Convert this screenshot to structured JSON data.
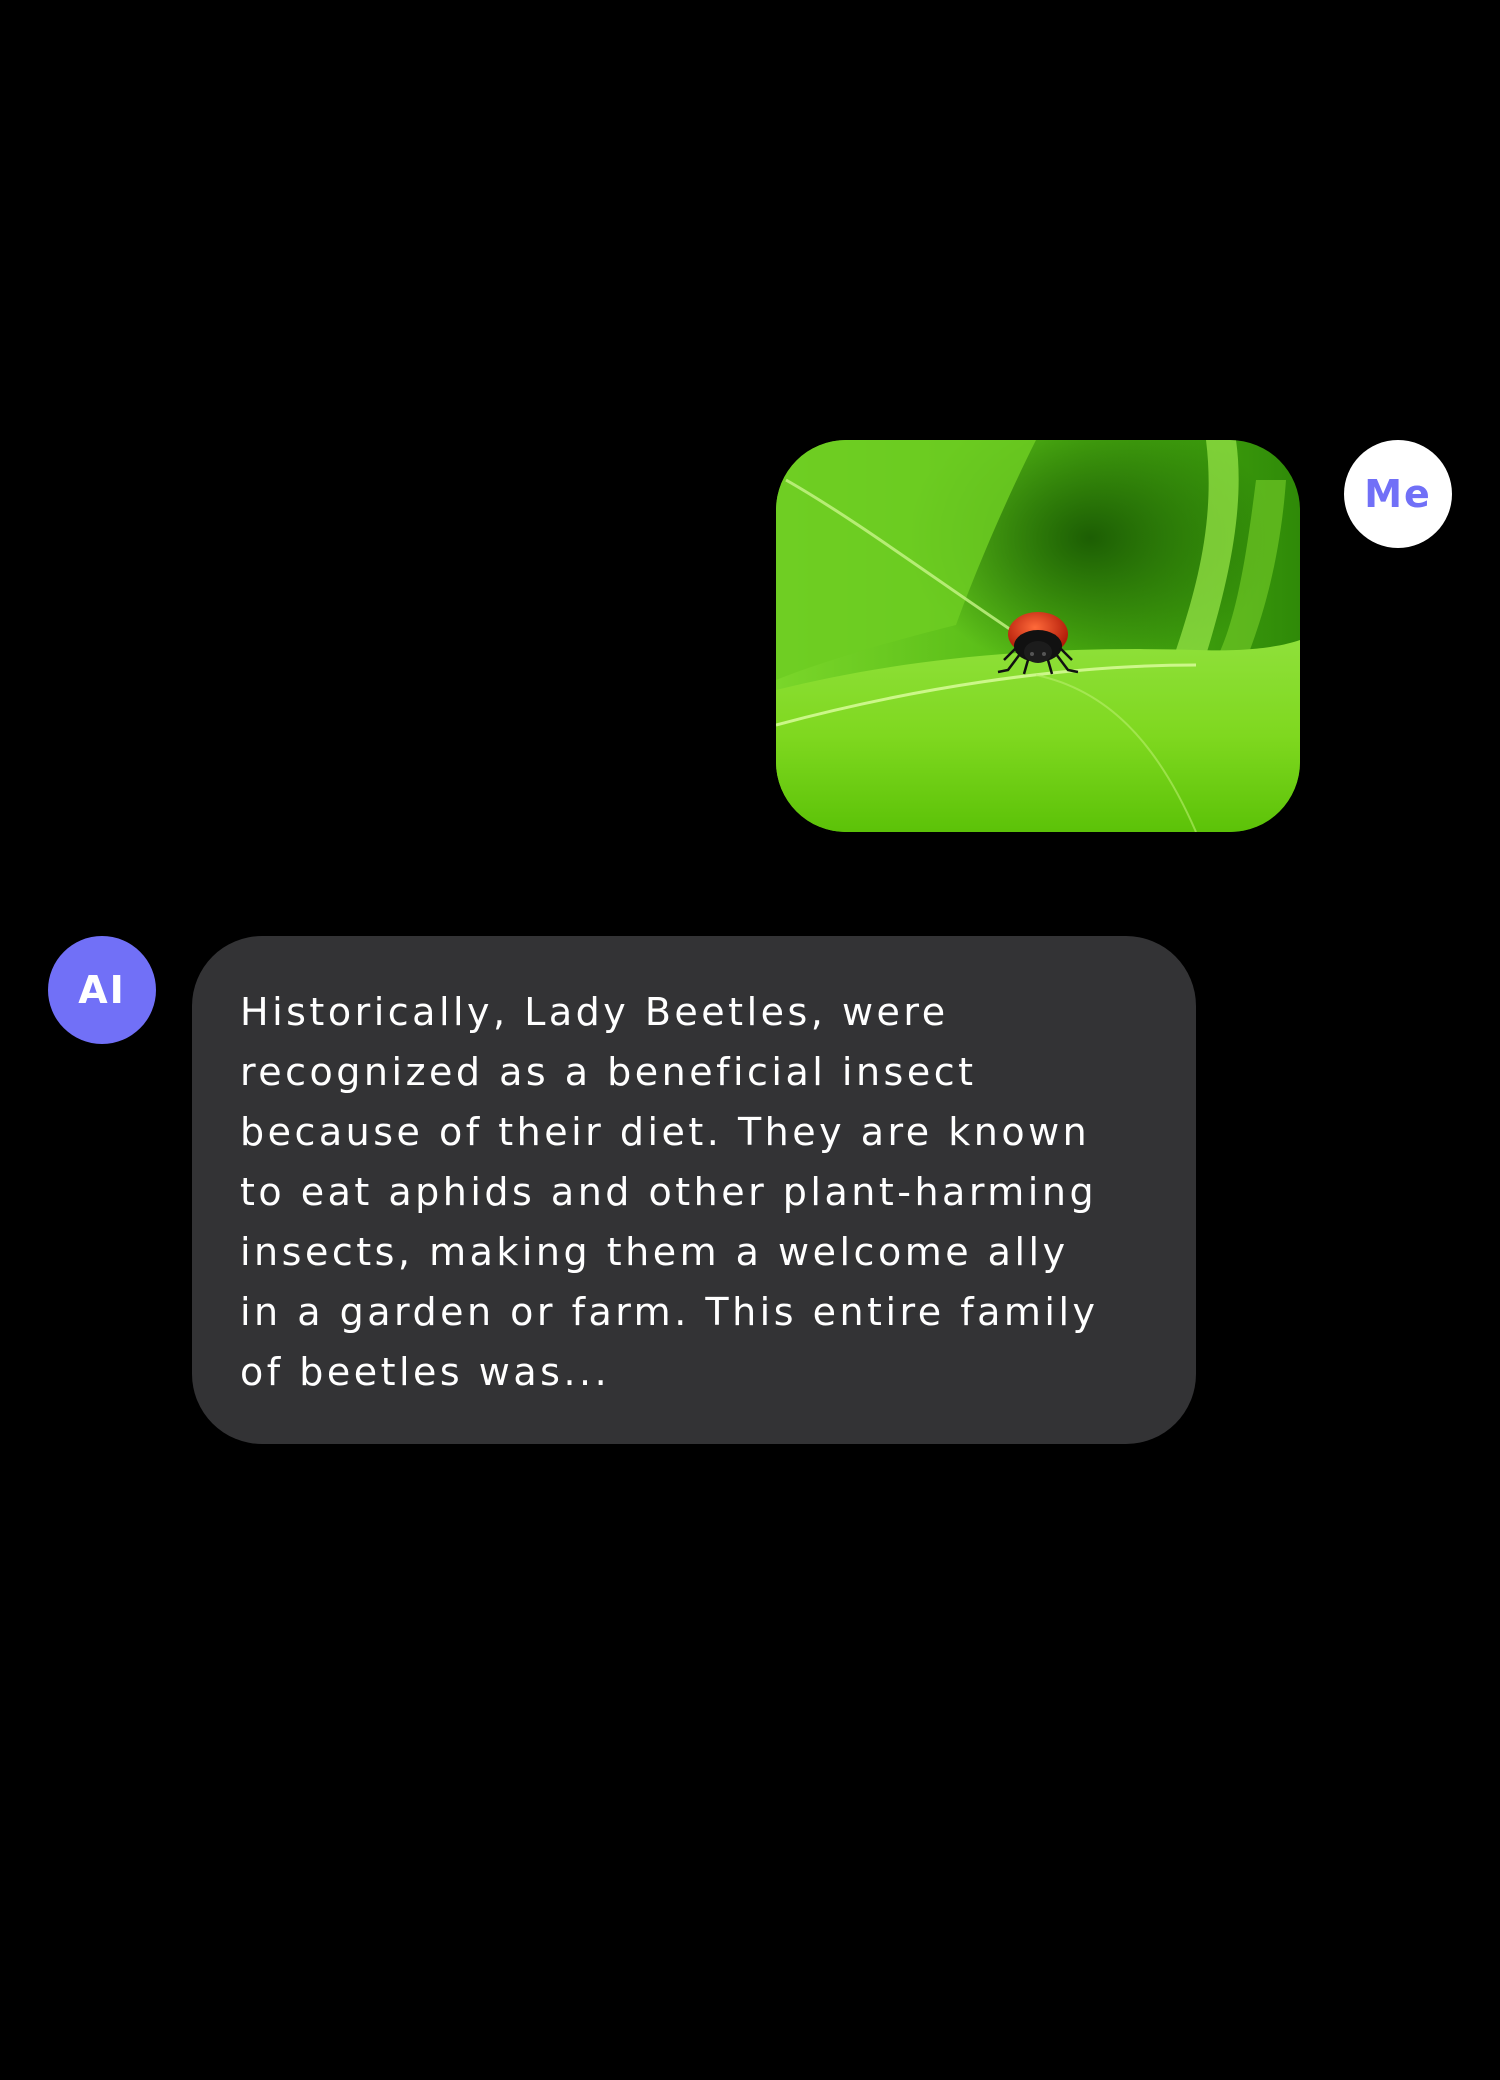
{
  "conversation": {
    "user": {
      "avatar_label": "Me",
      "avatar_bg": "#ffffff",
      "avatar_fg": "#7170f7"
    },
    "assistant": {
      "avatar_label": "AI",
      "avatar_bg": "#7170f7",
      "avatar_fg": "#ffffff"
    },
    "messages": [
      {
        "sender": "user",
        "type": "image",
        "image_subject": "ladybug on green leaf"
      },
      {
        "sender": "assistant",
        "type": "text",
        "text": "Historically, Lady Beetles, were\nrecognized as a beneficial insect\nbecause of their diet. They are known\nto eat aphids and other plant-harming\ninsects, making them a welcome ally\nin a garden or farm. This entire family\nof beetles was..."
      }
    ]
  },
  "colors": {
    "background": "#000000",
    "assistant_bubble": "#333335",
    "accent": "#7170f7"
  }
}
